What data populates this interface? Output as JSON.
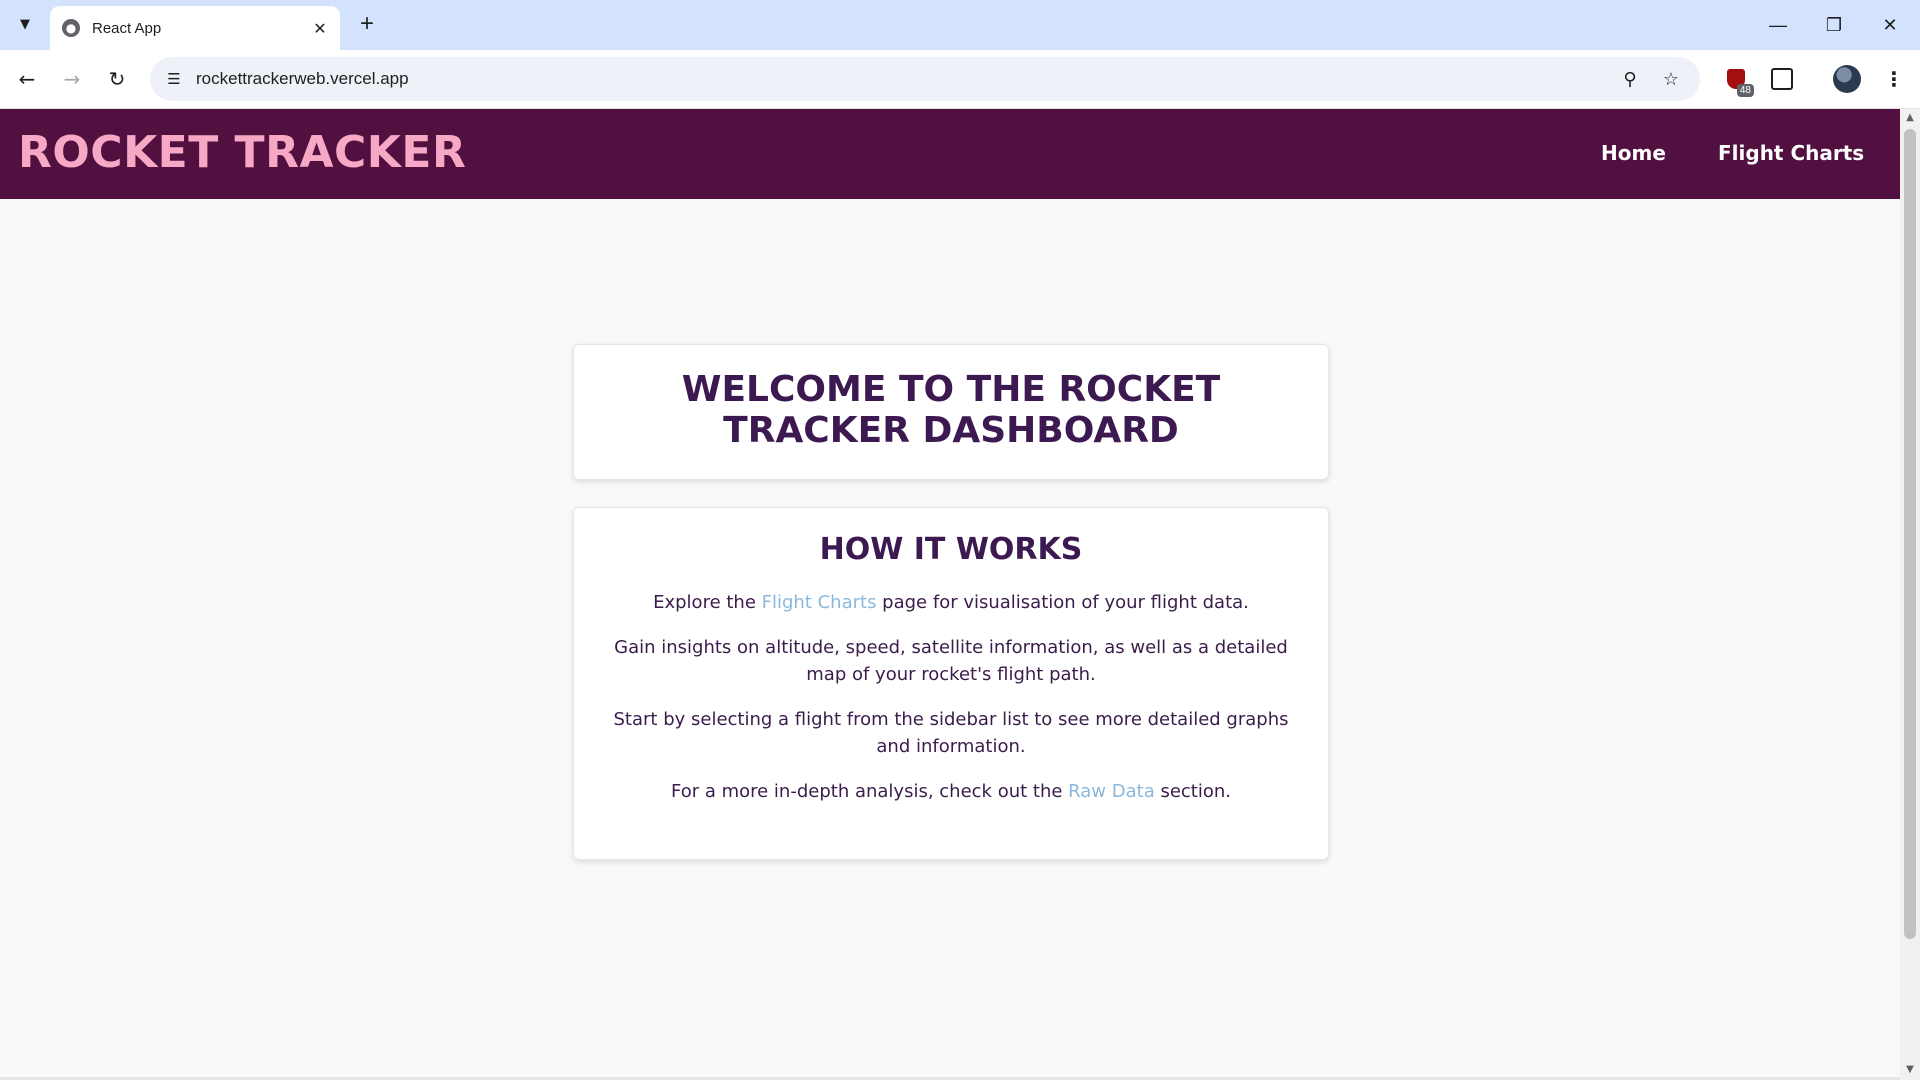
{
  "browser": {
    "tab_title": "React App",
    "url": "rockettrackerweb.vercel.app",
    "extension_badge": "48"
  },
  "app": {
    "brand": "ROCKET TRACKER",
    "nav": {
      "home": "Home",
      "flight_charts": "Flight Charts"
    }
  },
  "welcome": {
    "heading": "WELCOME TO THE ROCKET TRACKER DASHBOARD"
  },
  "how_it_works": {
    "heading": "HOW IT WORKS",
    "p1_before": "Explore the ",
    "p1_link": "Flight Charts",
    "p1_after": " page for visualisation of your flight data.",
    "p2": "Gain insights on altitude, speed, satellite information, as well as a detailed map of your rocket's flight path.",
    "p3": "Start by selecting a flight from the sidebar list to see more detailed graphs and information.",
    "p4_before": "For a more in-depth analysis, check out the ",
    "p4_link": "Raw Data",
    "p4_after": " section."
  },
  "colors": {
    "appbar": "#521041",
    "brand": "#f7a8c4",
    "heading": "#3c1950",
    "link": "#8ab8dd"
  },
  "icons": [
    "tab-search-icon",
    "globe-icon",
    "close-icon",
    "plus-icon",
    "minimize-icon",
    "restore-icon",
    "window-close-icon",
    "back-icon",
    "forward-icon",
    "reload-icon",
    "site-info-icon",
    "zoom-icon",
    "star-icon",
    "shield-extension-icon",
    "puzzle-icon",
    "avatar",
    "more-icon"
  ]
}
